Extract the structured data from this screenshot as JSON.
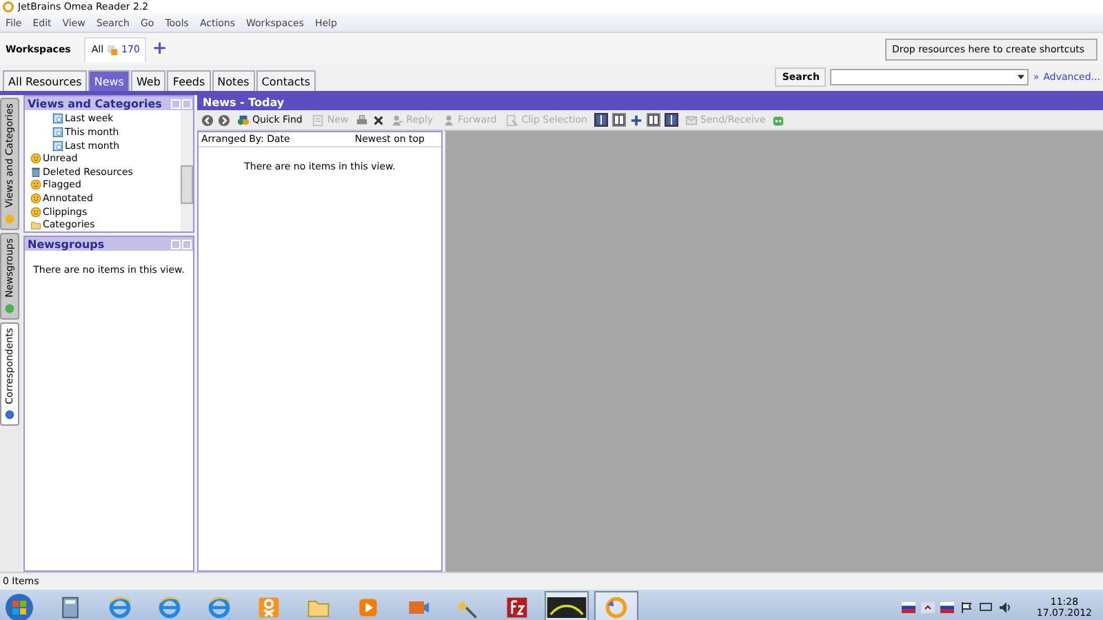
{
  "window": {
    "title": "JetBrains Omea Reader 2.2"
  },
  "menu": [
    "File",
    "Edit",
    "View",
    "Search",
    "Go",
    "Tools",
    "Actions",
    "Workspaces",
    "Help"
  ],
  "workspaces": {
    "label": "Workspaces",
    "tabs": [
      {
        "label": "All",
        "count": "170",
        "selected": true
      }
    ],
    "add": "+",
    "shortcuts_hint": "Drop resources here to create shortcuts"
  },
  "tabs": [
    {
      "label": "All Resources",
      "selected": false
    },
    {
      "label": "News",
      "selected": true
    },
    {
      "label": "Web",
      "selected": false
    },
    {
      "label": "Feeds",
      "selected": false
    },
    {
      "label": "Notes",
      "selected": false
    },
    {
      "label": "Contacts",
      "selected": false
    }
  ],
  "search": {
    "label": "Search",
    "advanced_glyph": "»",
    "advanced": "Advanced..."
  },
  "side_tabs": [
    {
      "label": "Views and Categories",
      "selected": true
    },
    {
      "label": "Newsgroups",
      "selected": true
    },
    {
      "label": "Correspondents",
      "selected": false
    }
  ],
  "views_pane": {
    "title": "Views and Categories",
    "tree": {
      "continued_children": [
        {
          "label": "Last week",
          "kind": "date"
        },
        {
          "label": "This month",
          "kind": "date"
        },
        {
          "label": "Last month",
          "kind": "date"
        }
      ],
      "items": [
        {
          "label": "Unread",
          "kind": "view"
        },
        {
          "label": "Deleted Resources",
          "kind": "trash"
        },
        {
          "label": "Flagged",
          "kind": "view"
        },
        {
          "label": "Annotated",
          "kind": "view"
        },
        {
          "label": "Clippings",
          "kind": "view"
        },
        {
          "label": "Categories",
          "kind": "folder"
        }
      ]
    }
  },
  "newsgroups_pane": {
    "title": "Newsgroups",
    "empty": "There are no items in this view."
  },
  "news": {
    "title": "News - Today",
    "toolbar": [
      {
        "kind": "back"
      },
      {
        "kind": "forward"
      },
      {
        "kind": "find",
        "label": "Quick Find",
        "disabled": false
      },
      {
        "kind": "new",
        "label": "New",
        "disabled": true
      },
      {
        "kind": "print",
        "disabled": false
      },
      {
        "kind": "delete",
        "disabled": false
      },
      {
        "kind": "reply",
        "label": "Reply",
        "disabled": true
      },
      {
        "kind": "forwardmail",
        "label": "Forward",
        "disabled": true
      },
      {
        "kind": "clip",
        "label": "Clip Selection",
        "disabled": true
      },
      {
        "kind": "layout",
        "selected": true
      },
      {
        "kind": "layout",
        "selected": false
      },
      {
        "kind": "split"
      },
      {
        "kind": "layout",
        "selected": false
      },
      {
        "kind": "layout",
        "selected": true
      },
      {
        "kind": "send",
        "label": "Send/Receive",
        "disabled": true
      },
      {
        "kind": "chat"
      }
    ],
    "arranged_by": "Arranged By: Date",
    "sort": "Newest on top",
    "empty": "There are no items in this view."
  },
  "status_bar": {
    "text": "0 Items"
  },
  "taskbar": {
    "apps": [
      {
        "kind": "calculator",
        "selected": false
      },
      {
        "kind": "browser",
        "selected": false
      },
      {
        "kind": "browser",
        "selected": false
      },
      {
        "kind": "browser",
        "selected": false
      },
      {
        "kind": "social",
        "selected": false
      },
      {
        "kind": "folder",
        "selected": false
      },
      {
        "kind": "media",
        "selected": false
      },
      {
        "kind": "media2",
        "selected": false
      },
      {
        "kind": "wand",
        "selected": false
      },
      {
        "kind": "ftp",
        "selected": false
      },
      {
        "kind": "video",
        "selected": true
      },
      {
        "kind": "reader",
        "selected": true
      }
    ],
    "time": "11:28",
    "date": "17.07.2012"
  }
}
